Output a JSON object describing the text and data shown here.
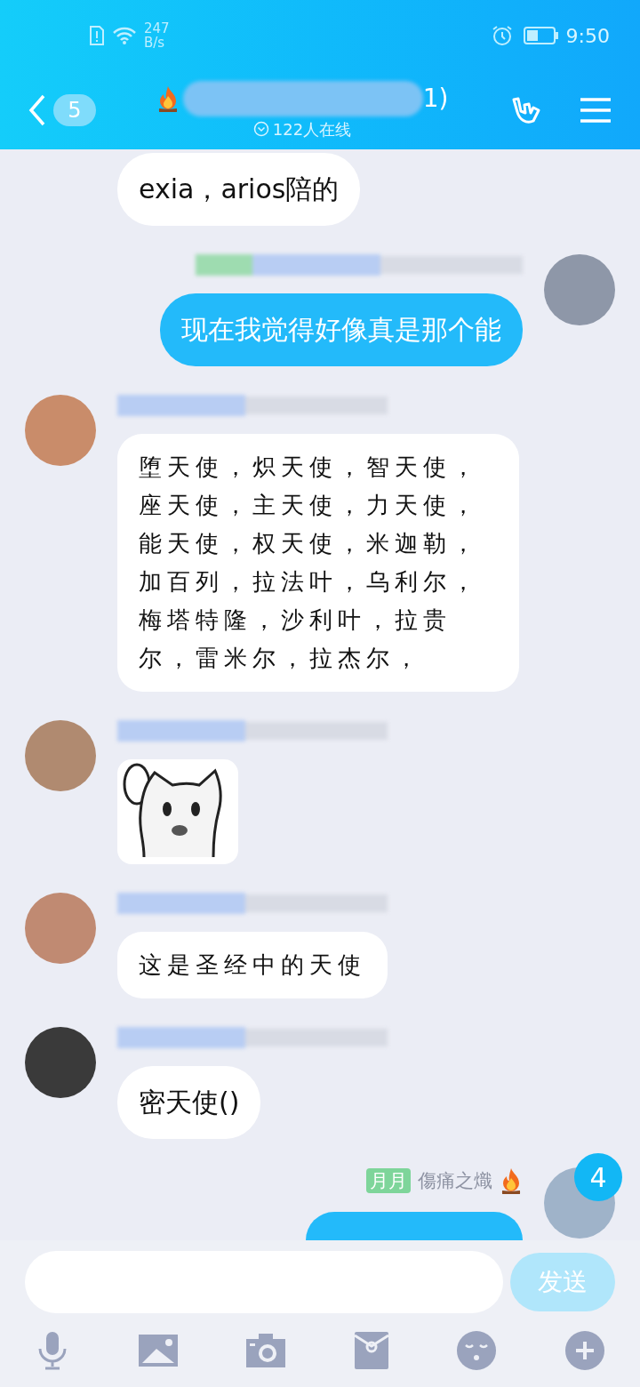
{
  "status_bar": {
    "network_speed": "247",
    "network_unit": "B/s",
    "time": "9:50"
  },
  "header": {
    "back_count": "5",
    "title_visible": "1)",
    "online": "122人在线"
  },
  "messages": [
    {
      "kind": "partial",
      "outgoing": false,
      "text": "exia，arios陪的"
    },
    {
      "kind": "text",
      "outgoing": true,
      "text": "现在我觉得好像真是那个能"
    },
    {
      "kind": "handwritten",
      "outgoing": false,
      "text": "堕天使，炽天使，智天使，座天使，主天使，力天使，能天使，权天使，米迦勒，加百列，拉法叶，乌利尔，梅塔特隆，沙利叶，拉贵尔，雷米尔，拉杰尔，"
    },
    {
      "kind": "sticker",
      "outgoing": false
    },
    {
      "kind": "handwritten",
      "outgoing": false,
      "text": "这是圣经中的天使"
    },
    {
      "kind": "text",
      "outgoing": false,
      "text": "密天使()"
    },
    {
      "kind": "cut",
      "outgoing": true,
      "tag": "月月",
      "name": "傷痛之熾",
      "badge": "4"
    }
  ],
  "composer": {
    "send_button": "发送",
    "send_disabled": true
  }
}
